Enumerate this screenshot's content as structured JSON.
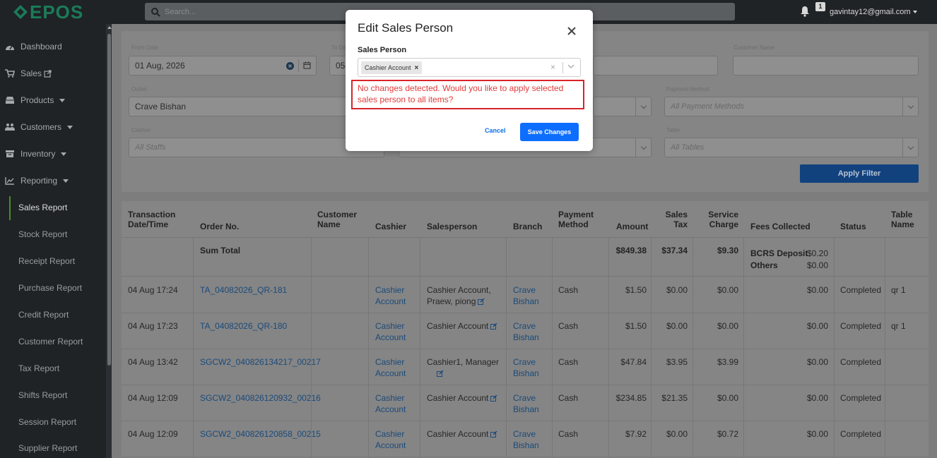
{
  "app": {
    "logo_text": "EPOS"
  },
  "topbar": {
    "search_placeholder": "Search...",
    "notification_count": "1",
    "user_email": "gavintay12@gmail.com"
  },
  "sidebar": {
    "items": [
      {
        "label": "Dashboard",
        "icon": "tachometer-icon"
      },
      {
        "label": "Sales",
        "icon": "cart-icon"
      },
      {
        "label": "Products",
        "icon": "box-icon"
      },
      {
        "label": "Customers",
        "icon": "users-icon"
      },
      {
        "label": "Inventory",
        "icon": "archive-icon"
      },
      {
        "label": "Reporting",
        "icon": "chart-icon"
      }
    ],
    "subitems": [
      "Sales Report",
      "Stock Report",
      "Receipt Report",
      "Purchase Report",
      "Credit Report",
      "Customer Report",
      "Tax Report",
      "Shifts Report",
      "Session Report",
      "Supplier Report"
    ],
    "active": "Sales Report"
  },
  "filters": {
    "from_date_label": "From Date",
    "from_date": "01 Aug, 2026",
    "to_date_label": "To Date",
    "to_date_partial": "05",
    "customer_name_label": "Customer Name",
    "outlet_label": "Outlet",
    "outlet": "Crave Bishan",
    "payment_method_label": "Payment Method",
    "payment_method_placeholder": "All Payment Methods",
    "cashier_label": "Cashier",
    "cashier_placeholder": "All Staffs",
    "table_label": "Table",
    "table_placeholder": "All Tables",
    "apply_label": "Apply Filter"
  },
  "table": {
    "headers": {
      "datetime": [
        "Transaction",
        "Date/Time"
      ],
      "order": "Order No.",
      "customer": [
        "Customer",
        "Name"
      ],
      "cashier": "Cashier",
      "salesperson": "Salesperson",
      "branch": "Branch",
      "payment": [
        "Payment",
        "Method"
      ],
      "amount": "Amount",
      "tax": [
        "Sales",
        "Tax"
      ],
      "service": [
        "Service",
        "Charge"
      ],
      "fees": "Fees Collected",
      "status": "Status",
      "table_name": [
        "Table",
        "Name"
      ]
    },
    "sum": {
      "label": "Sum Total",
      "amount": "$849.38",
      "tax": "$37.34",
      "service": "$9.30",
      "fee1_label": "BCRS Deposit",
      "fee1_value": "$0.20",
      "fee2_label": "Others",
      "fee2_value": "$0.00"
    },
    "rows": [
      {
        "datetime": "04 Aug 17:24",
        "order": "TA_04082026_QR-181",
        "cashier": [
          "Cashier",
          "Account"
        ],
        "salesperson": [
          "Cashier Account,",
          "Praew, piong"
        ],
        "branch": [
          "Crave",
          "Bishan"
        ],
        "payment": "Cash",
        "amount": "$1.50",
        "tax": "$0.00",
        "service": "$0.00",
        "fees": "$0.00",
        "status": "Completed",
        "table_name": "qr 1"
      },
      {
        "datetime": "04 Aug 17:23",
        "order": "TA_04082026_QR-180",
        "cashier": [
          "Cashier",
          "Account"
        ],
        "salesperson": [
          "Cashier Account",
          ""
        ],
        "branch": [
          "Crave",
          "Bishan"
        ],
        "payment": "Cash",
        "amount": "$1.50",
        "tax": "$0.00",
        "service": "$0.00",
        "fees": "$0.00",
        "status": "Completed",
        "table_name": "qr 1"
      },
      {
        "datetime": "04 Aug 13:42",
        "order": "SGCW2_040826134217_00217",
        "cashier": [
          "Cashier",
          "Account"
        ],
        "salesperson": [
          "Cashier1, Manager",
          ""
        ],
        "branch": [
          "Crave",
          "Bishan"
        ],
        "payment": "Cash",
        "amount": "$47.84",
        "tax": "$3.95",
        "service": "$3.99",
        "fees": "$0.00",
        "status": "Completed",
        "table_name": ""
      },
      {
        "datetime": "04 Aug 12:09",
        "order": "SGCW2_040826120932_00216",
        "cashier": [
          "Cashier",
          "Account"
        ],
        "salesperson": [
          "Cashier Account",
          ""
        ],
        "branch": [
          "Crave",
          "Bishan"
        ],
        "payment": "Cash",
        "amount": "$234.85",
        "tax": "$21.35",
        "service": "$0.00",
        "fees": "$0.00",
        "status": "Completed",
        "table_name": ""
      },
      {
        "datetime": "04 Aug 12:09",
        "order": "SGCW2_040826120858_00215",
        "cashier": [
          "Cashier",
          "Account"
        ],
        "salesperson": [
          "Cashier Account",
          ""
        ],
        "branch": [
          "Crave",
          "Bishan"
        ],
        "payment": "Cash",
        "amount": "$7.92",
        "tax": "$0.00",
        "service": "$0.72",
        "fees": "$0.00",
        "status": "Completed",
        "table_name": ""
      }
    ]
  },
  "modal": {
    "title": "Edit Sales Person",
    "field_label": "Sales Person",
    "selected_chip": "Cashier Account",
    "warning": "No changes detected. Would you like to apply selected sales person to all items?",
    "cancel_label": "Cancel",
    "save_label": "Save Changes"
  },
  "colors": {
    "accent": "#0d6efd",
    "warning": "#d8232a",
    "brand": "#1c7b58"
  }
}
